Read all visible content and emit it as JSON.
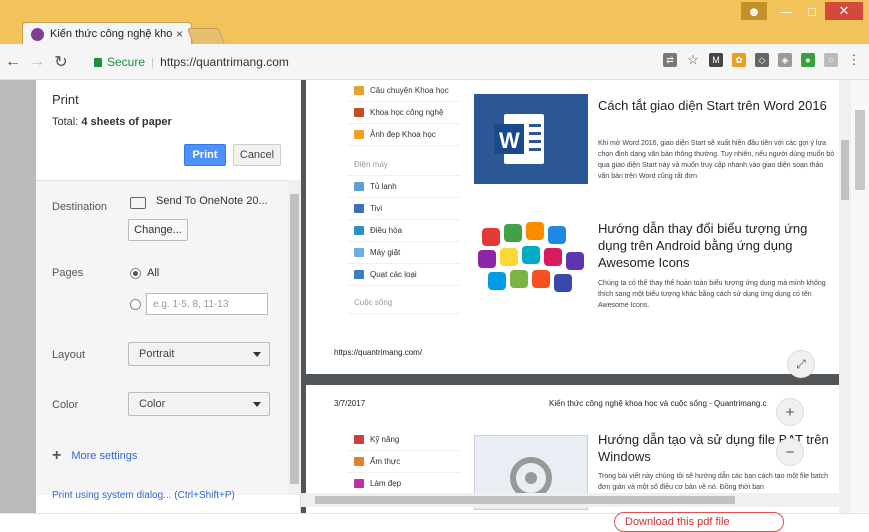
{
  "browser": {
    "tab_title": "Kiến thức công nghệ khoa",
    "tab_close": "×",
    "secure_label": "Secure",
    "url": "https://quantrimang.com",
    "window_controls": [
      "user-icon",
      "minimize-icon",
      "maximize-icon",
      "close-icon"
    ]
  },
  "print": {
    "title": "Print",
    "total_label": "Total:",
    "total_value": "4 sheets of paper",
    "print_button": "Print",
    "cancel_button": "Cancel",
    "destination_label": "Destination",
    "destination_value": "Send To OneNote 20...",
    "change_button": "Change...",
    "pages_label": "Pages",
    "pages_all": "All",
    "pages_placeholder": "e.g. 1-5, 8, 11-13",
    "layout_label": "Layout",
    "layout_value": "Portrait",
    "color_label": "Color",
    "color_value": "Color",
    "more_settings": "More settings",
    "system_dialog": "Print using system dialog... (Ctrl+Shift+P)"
  },
  "preview": {
    "page1": {
      "menu": [
        {
          "label": "Câu chuyện Khoa học",
          "color": "#e8a030"
        },
        {
          "label": "Khoa học công nghệ",
          "color": "#c05020"
        },
        {
          "label": "Ảnh đẹp Khoa học",
          "color": "#f0a020"
        },
        {
          "label": "Điện máy",
          "color": "",
          "gray": true
        },
        {
          "label": "Tủ lạnh",
          "color": "#5aa0d8"
        },
        {
          "label": "Tivi",
          "color": "#3a70b8"
        },
        {
          "label": "Điều hòa",
          "color": "#2a90c8"
        },
        {
          "label": "Máy giặt",
          "color": "#6ab0e0"
        },
        {
          "label": "Quạt các loại",
          "color": "#3a80c0"
        },
        {
          "label": "Cuộc sống",
          "color": "",
          "gray": true
        }
      ],
      "article1_title": "Cách tắt giao diện Start trên Word 2016",
      "article1_desc": "Khi mở Word 2016, giao diện Start sẽ xuất hiện đầu tiên với các gợi ý lựa chọn định dạng văn bản thông thường. Tuy nhiên, nếu người dùng muốn bỏ qua giao diện Start này và muốn truy cập nhanh vào giao diện soạn thảo văn bản trên Word cũng rất đơn",
      "article2_title": "Hướng dẫn thay đổi biểu tượng ứng dụng trên Android bằng ứng dụng Awesome Icons",
      "article2_desc": "Chúng ta có thể thay thế hoàn toàn biểu tượng ứng dụng mà mình không thích sang một biểu tượng khác bằng cách sử dụng ứng dụng có tên Awesome Icons.",
      "footer_url": "https://quantrimang.com/"
    },
    "page2": {
      "date": "3/7/2017",
      "site_title": "Kiến thức công nghệ khoa học và cuộc sống - Quantrimang.c",
      "menu": [
        {
          "label": "Kỹ năng",
          "color": "#c84040"
        },
        {
          "label": "Ẩm thực",
          "color": "#e08030"
        },
        {
          "label": "Làm đẹp",
          "color": "#c030a0"
        }
      ],
      "article3_title": "Hướng dẫn tạo và sử dụng file BAT trên Windows",
      "article3_desc": "Trong bài viết này chúng tôi sẽ hướng dẫn các bạn cách tạo một file batch đơn giản và một số điều cơ bản về nó. Đồng thời bạn"
    },
    "zoom_fit": "⤢",
    "zoom_in": "+",
    "zoom_out": "−"
  },
  "download_link": "Download this pdf file"
}
